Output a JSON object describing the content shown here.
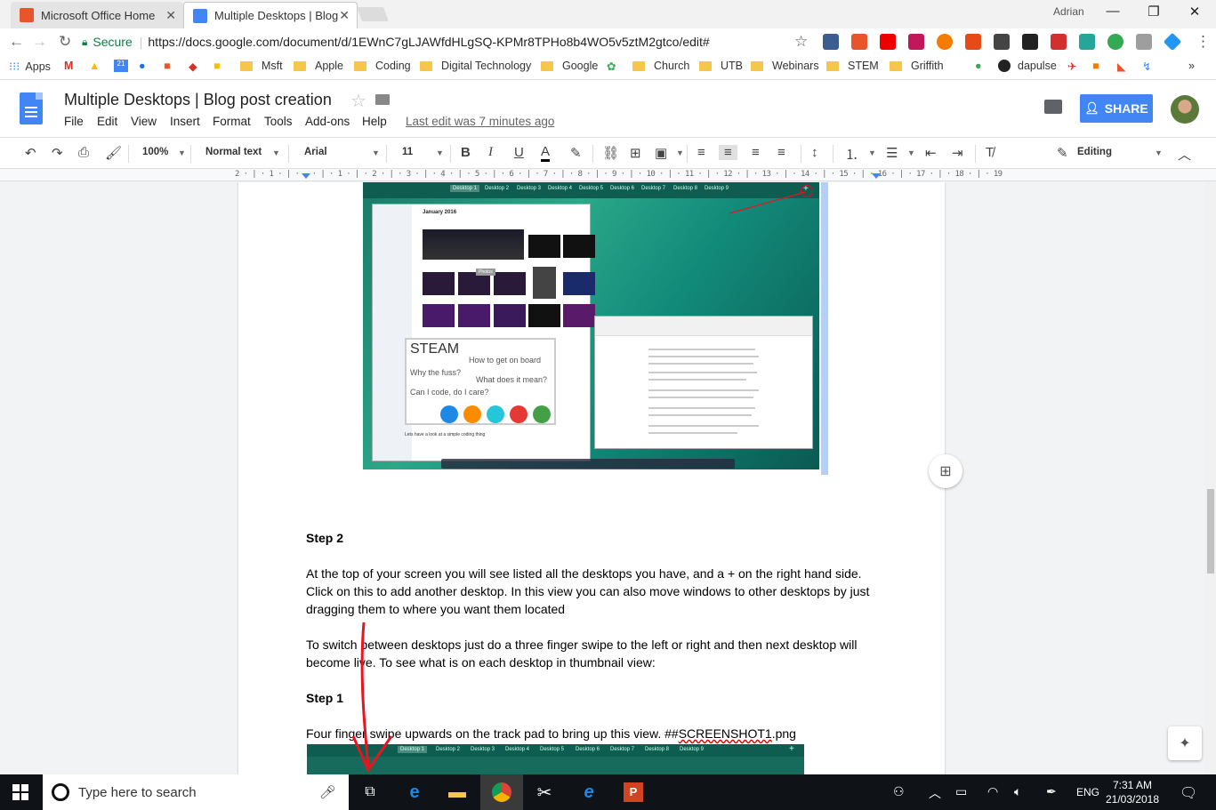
{
  "browser": {
    "tabs": [
      {
        "title": "Microsoft Office Home",
        "favicon_color": "#e8552b",
        "active": false
      },
      {
        "title": "Multiple Desktops | Blog",
        "favicon_color": "#4285f4",
        "active": true
      }
    ],
    "profile_name": "Adrian",
    "window_buttons": {
      "minimize": "—",
      "restore": "❐",
      "close": "✕"
    },
    "secure_label": "Secure",
    "url": "https://docs.google.com/document/d/1EWnC7gLJAWfdHLgSQ-KPMr8TPHo8b4WO5v5ztM2gtco/edit#",
    "bookmarks": [
      {
        "label": "Apps",
        "type": "apps"
      },
      {
        "label": "",
        "type": "gmail"
      },
      {
        "label": "",
        "type": "drive"
      },
      {
        "label": "",
        "type": "calendar"
      },
      {
        "label": "",
        "type": "app"
      },
      {
        "label": "",
        "type": "app"
      },
      {
        "label": "",
        "type": "app"
      },
      {
        "label": "",
        "type": "app"
      },
      {
        "label": "Msft",
        "type": "folder"
      },
      {
        "label": "Apple",
        "type": "folder"
      },
      {
        "label": "Coding",
        "type": "folder"
      },
      {
        "label": "Digital Technology",
        "type": "folder"
      },
      {
        "label": "Google",
        "type": "folder"
      },
      {
        "label": "",
        "type": "app"
      },
      {
        "label": "Church",
        "type": "folder"
      },
      {
        "label": "UTB",
        "type": "folder"
      },
      {
        "label": "Webinars",
        "type": "folder"
      },
      {
        "label": "STEM",
        "type": "folder"
      },
      {
        "label": "Griffith",
        "type": "folder"
      },
      {
        "label": "",
        "type": "app"
      },
      {
        "label": "dapulse",
        "type": "site"
      }
    ],
    "bookmarks_overflow": "»"
  },
  "docs": {
    "title": "Multiple Desktops | Blog post creation",
    "menus": [
      "File",
      "Edit",
      "View",
      "Insert",
      "Format",
      "Tools",
      "Add-ons",
      "Help"
    ],
    "last_edit": "Last edit was 7 minutes ago",
    "share_label": "SHARE",
    "toolbar": {
      "zoom": "100%",
      "style": "Normal text",
      "font": "Arial",
      "font_size": "11",
      "mode": "Editing"
    },
    "ruler_text": "2 · | · 1 · | ·   · | · 1 · | · 2 · | · 3 · | · 4 · | · 5 · | · 6 · | · 7 · | · 8 · | · 9 · | · 10 · | · 11 · | · 12 · | · 13 · | · 14 · | · 15 · | · 16 · | · 17 · | · 18 · | · 19"
  },
  "embedded_screenshot_1": {
    "desktops": [
      "Desktop 1",
      "Desktop 2",
      "Desktop 3",
      "Desktop 4",
      "Desktop 5",
      "Desktop 6",
      "Desktop 7",
      "Desktop 8",
      "Desktop 9"
    ],
    "add_symbol": "+",
    "photos_header": "January 2016",
    "photos_tooltip": "Photos",
    "steam": {
      "title": "STEAM",
      "lines": [
        "How to get on board",
        "Why the fuss?",
        "What does it mean?",
        "Can I code, do I care?"
      ],
      "caption": "Lets have a look at a simple coding thing"
    }
  },
  "content": {
    "step2_heading": "Step 2",
    "p1": "At the top of your screen you will see listed all the desktops you have, and a + on the right hand side. Click on this to add another desktop. In this view you can also move windows to other desktops by just dragging them to where you want them located",
    "p2": "To switch between desktops just do a three finger swipe to the left or right and then next desktop will become live. To see what is on each desktop in thumbnail view:",
    "step1_heading": "Step 1",
    "p3_prefix": "Four finger swipe upwards on the track pad to bring up this view. ##",
    "p3_ref": "SCREENSHOT1",
    "p3_suffix": ".png"
  },
  "embedded_screenshot_2": {
    "desktops": [
      "Desktop 1",
      "Desktop 2",
      "Desktop 3",
      "Desktop 4",
      "Desktop 5",
      "Desktop 6",
      "Desktop 7",
      "Desktop 8",
      "Desktop 9"
    ],
    "add_symbol": "+"
  },
  "taskbar": {
    "search_placeholder": "Type here to search",
    "language": "ENG",
    "time": "7:31 AM",
    "date": "21/03/2018"
  },
  "colors": {
    "annotation_red": "#e8141e",
    "docs_blue": "#4285f4",
    "secure_green": "#0b8043"
  }
}
